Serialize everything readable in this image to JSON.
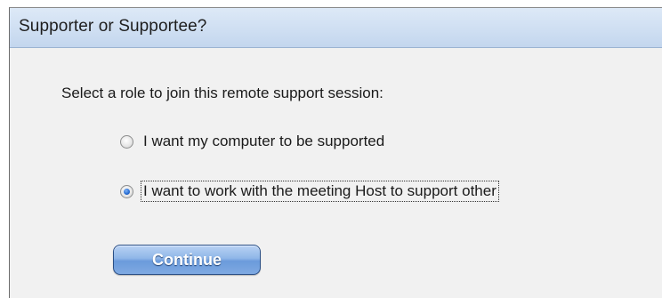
{
  "dialog": {
    "title": "Supporter or Supportee?",
    "prompt": "Select a role to join this remote support session:",
    "options": [
      {
        "label": "I want my computer to be supported",
        "checked": false
      },
      {
        "label": "I want to work with the meeting Host to support other",
        "checked": true
      }
    ],
    "continue_label": "Continue"
  },
  "colors": {
    "titlebar": "#cfdff2",
    "background": "#f1f1f1",
    "button": "#7fa9e2"
  }
}
